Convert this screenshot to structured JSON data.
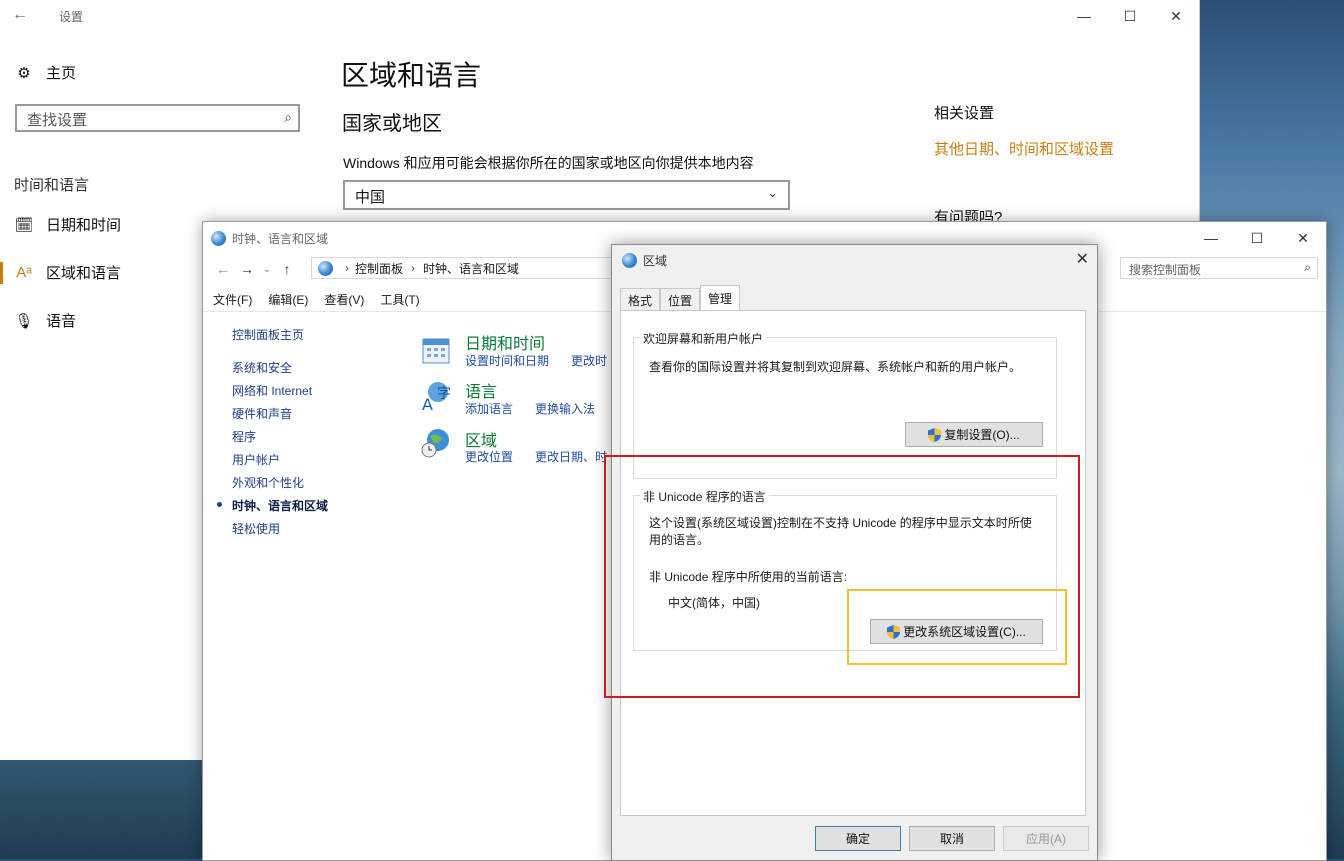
{
  "settings": {
    "title": "设置",
    "home_label": "主页",
    "search_placeholder": "查找设置",
    "section_label": "时间和语言",
    "nav": [
      {
        "label": "日期和时间"
      },
      {
        "label": "区域和语言"
      },
      {
        "label": "语音"
      }
    ],
    "page_title": "区域和语言",
    "country_heading": "国家或地区",
    "country_desc": "Windows 和应用可能会根据你所在的国家或地区向你提供本地内容",
    "country_value": "中国",
    "related_heading": "相关设置",
    "related_link": "其他日期、时间和区域设置",
    "question_heading": "有问题吗?"
  },
  "control_panel": {
    "title": "时钟、语言和区域",
    "breadcrumb": [
      "控制面板",
      "时钟、语言和区域"
    ],
    "search_placeholder": "搜索控制面板",
    "menu": [
      "文件(F)",
      "编辑(E)",
      "查看(V)",
      "工具(T)"
    ],
    "sidebar": [
      "控制面板主页",
      "系统和安全",
      "网络和 Internet",
      "硬件和声音",
      "程序",
      "用户帐户",
      "外观和个性化",
      "时钟、语言和区域",
      "轻松使用"
    ],
    "categories": [
      {
        "title": "日期和时间",
        "links": [
          "设置时间和日期",
          "更改时"
        ]
      },
      {
        "title": "语言",
        "links": [
          "添加语言",
          "更换输入法"
        ]
      },
      {
        "title": "区域",
        "links": [
          "更改位置",
          "更改日期、时"
        ]
      }
    ]
  },
  "region_dialog": {
    "title": "区域",
    "tabs": [
      "格式",
      "位置",
      "管理"
    ],
    "active_tab": "管理",
    "welcome_group": {
      "legend": "欢迎屏幕和新用户帐户",
      "desc": "查看你的国际设置并将其复制到欢迎屏幕、系统帐户和新的用户帐户。",
      "button": "复制设置(O)..."
    },
    "unicode_group": {
      "legend": "非 Unicode 程序的语言",
      "desc_line1": "这个设置(系统区域设置)控制在不支持 Unicode 的程序中显示文本时所使",
      "desc_line2": "用的语言。",
      "current_label": "非 Unicode 程序中所使用的当前语言:",
      "current_value": "中文(简体，中国)",
      "button": "更改系统区域设置(C)..."
    },
    "ok": "确定",
    "cancel": "取消",
    "apply": "应用(A)"
  },
  "colors": {
    "accent": "#c87f12",
    "highlight_red": "#c81e1e",
    "highlight_yellow": "#f2c12b",
    "link_blue": "#1e4ea8",
    "category_green": "#0a7a3a"
  }
}
